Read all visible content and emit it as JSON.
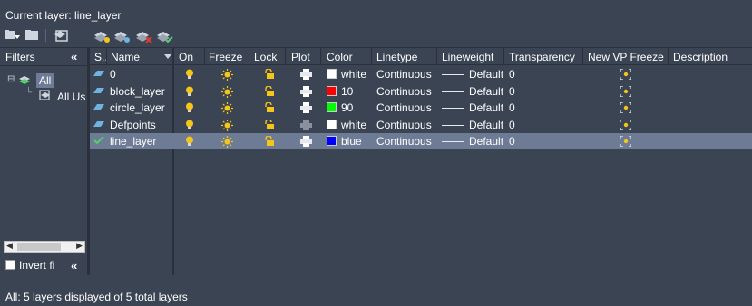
{
  "current_layer": "Current layer: line_layer",
  "toolbar": {
    "buttons": [
      "new-property-filter-icon",
      "new-group-filter-icon",
      "layer-states-manager-icon",
      "new-layer-icon",
      "new-layer-vp-frozen-icon",
      "delete-layer-icon",
      "set-current-icon"
    ]
  },
  "filters": {
    "header": "Filters",
    "collapse": "«",
    "tree": {
      "all": "All",
      "all_used": "All Us"
    },
    "invert": "Invert fi",
    "invert_collapse": "«"
  },
  "columns": [
    "S..",
    "Name",
    "On",
    "Freeze",
    "Lock",
    "Plot",
    "Color",
    "Linetype",
    "Lineweight",
    "Transparency",
    "New VP Freeze",
    "Description"
  ],
  "layers": [
    {
      "status": "layer",
      "name": "0",
      "color_hex": "#ffffff",
      "color": "white",
      "linetype": "Continuous",
      "lineweight": "Default",
      "transparency": "0",
      "plot_disabled": false,
      "selected": false
    },
    {
      "status": "layer",
      "name": "block_layer",
      "color_hex": "#ff0000",
      "color": "10",
      "linetype": "Continuous",
      "lineweight": "Default",
      "transparency": "0",
      "plot_disabled": false,
      "selected": false
    },
    {
      "status": "layer",
      "name": "circle_layer",
      "color_hex": "#00ff00",
      "color": "90",
      "linetype": "Continuous",
      "lineweight": "Default",
      "transparency": "0",
      "plot_disabled": false,
      "selected": false
    },
    {
      "status": "layer",
      "name": "Defpoints",
      "color_hex": "#ffffff",
      "color": "white",
      "linetype": "Continuous",
      "lineweight": "Default",
      "transparency": "0",
      "plot_disabled": true,
      "selected": false
    },
    {
      "status": "current",
      "name": "line_layer",
      "color_hex": "#0000ff",
      "color": "blue",
      "linetype": "Continuous",
      "lineweight": "Default",
      "transparency": "0",
      "plot_disabled": false,
      "selected": true
    }
  ],
  "status_bar": "All: 5 layers displayed of 5 total layers",
  "colors": {
    "background": "#3b4453",
    "selected_row": "#6e7b95",
    "bulb": "#f5c518",
    "current_check": "#4fd16b"
  }
}
